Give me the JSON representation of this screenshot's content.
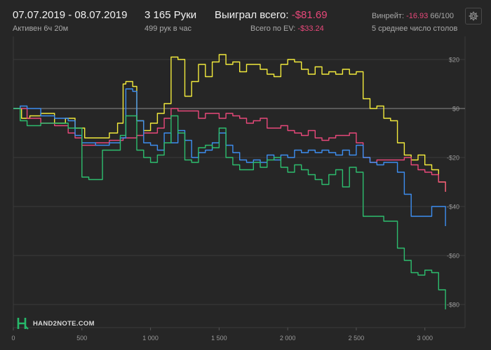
{
  "header": {
    "date_range": "07.07.2019 - 08.07.2019",
    "active_time": "Активен 6ч 20м",
    "hands": "3 165 Руки",
    "hands_per_hour": "499 рук в час",
    "won_label": "Выиграл всего:",
    "won_value": "-$81.69",
    "ev_label": "Всего по EV:",
    "ev_value": "-$33.24",
    "winrate_label": "Винрейт:",
    "winrate_value": "-16.93",
    "winrate_extra": "66/100",
    "tables_avg": "5 среднее число столов",
    "settings_icon": "gear-icon"
  },
  "logo": {
    "text": "HAND2NOTE.COM",
    "icon": "h2n-logo-icon"
  },
  "colors": {
    "background": "#262626",
    "grid": "#3a3a3a",
    "zero_line": "#8c8c8c",
    "yellow": "#f2ea3c",
    "pink": "#e8487a",
    "blue": "#3d8ef0",
    "green": "#2dbd6e"
  },
  "chart_data": {
    "type": "line",
    "xlim": [
      0,
      3165
    ],
    "ylim": [
      -86,
      26
    ],
    "x_ticks": [
      0,
      500,
      1000,
      1500,
      2000,
      2500,
      3000
    ],
    "x_tick_labels": [
      "0",
      "500",
      "1 000",
      "1 500",
      "2 000",
      "2 500",
      "3 000"
    ],
    "y_ticks": [
      20,
      0,
      -20,
      -40,
      -60,
      -80
    ],
    "y_tick_labels": [
      "$20",
      "$0",
      "-$20",
      "-$40",
      "-$60",
      "-$80"
    ],
    "grid": true,
    "series": [
      {
        "color": "#f2ea3c",
        "x": [
          0,
          60,
          120,
          200,
          300,
          380,
          450,
          520,
          600,
          700,
          760,
          800,
          820,
          870,
          900,
          950,
          1000,
          1050,
          1100,
          1150,
          1200,
          1250,
          1300,
          1350,
          1400,
          1450,
          1500,
          1550,
          1600,
          1650,
          1700,
          1750,
          1800,
          1850,
          1900,
          1950,
          2000,
          2050,
          2100,
          2150,
          2200,
          2250,
          2300,
          2350,
          2400,
          2450,
          2500,
          2550,
          2600,
          2650,
          2700,
          2750,
          2800,
          2850,
          2900,
          2950,
          3000,
          3050,
          3100,
          3150
        ],
        "y": [
          0,
          -4,
          -3,
          -2,
          -6,
          -4,
          -8,
          -12,
          -12,
          -10,
          -6,
          10,
          11,
          9,
          -5,
          -9,
          -6,
          -2,
          2,
          21,
          20,
          5,
          11,
          18,
          13,
          19,
          22,
          18,
          19,
          15,
          18,
          18,
          16,
          14,
          13,
          18,
          20,
          19,
          16,
          14,
          17,
          14,
          15,
          14,
          16,
          14,
          15,
          4,
          0,
          1,
          -4,
          -5,
          -14,
          -19,
          -21,
          -19,
          -23,
          -25,
          -30,
          -34
        ]
      },
      {
        "color": "#e8487a",
        "x": [
          0,
          100,
          200,
          300,
          400,
          450,
          500,
          560,
          600,
          700,
          800,
          850,
          900,
          950,
          1000,
          1050,
          1100,
          1150,
          1200,
          1250,
          1300,
          1350,
          1400,
          1450,
          1500,
          1550,
          1600,
          1650,
          1700,
          1750,
          1800,
          1850,
          1900,
          1950,
          2000,
          2050,
          2100,
          2150,
          2200,
          2250,
          2300,
          2350,
          2400,
          2450,
          2500,
          2550,
          2600,
          2650,
          2700,
          2750,
          2800,
          2850,
          2900,
          2950,
          3000,
          3050,
          3100,
          3150
        ],
        "y": [
          0,
          -4,
          -6,
          -7,
          -10,
          -12,
          -15,
          -15,
          -14,
          -13,
          -12,
          -12,
          -11,
          -10,
          -10,
          -8,
          -4,
          0,
          -1,
          -1,
          -1,
          -4,
          -2,
          -2,
          -4,
          -2,
          -3,
          -4,
          -6,
          -5,
          -4,
          -8,
          -8,
          -7,
          -9,
          -10,
          -11,
          -9,
          -12,
          -13,
          -12,
          -11,
          -11,
          -10,
          -14,
          -20,
          -22,
          -21,
          -21,
          -21,
          -21,
          -20,
          -23,
          -25,
          -26,
          -27,
          -30,
          -34
        ]
      },
      {
        "color": "#3d8ef0",
        "x": [
          0,
          50,
          100,
          200,
          300,
          400,
          450,
          500,
          550,
          600,
          700,
          780,
          820,
          870,
          900,
          950,
          1000,
          1050,
          1100,
          1150,
          1200,
          1250,
          1300,
          1350,
          1400,
          1450,
          1500,
          1550,
          1600,
          1650,
          1700,
          1750,
          1800,
          1850,
          1900,
          1950,
          2000,
          2050,
          2100,
          2150,
          2200,
          2250,
          2300,
          2350,
          2400,
          2450,
          2500,
          2550,
          2600,
          2650,
          2700,
          2750,
          2800,
          2850,
          2900,
          2950,
          3000,
          3050,
          3100,
          3150
        ],
        "y": [
          0,
          1,
          0,
          -3,
          -4,
          -5,
          -11,
          -14,
          -14,
          -15,
          -14,
          -12,
          8,
          7,
          -5,
          -14,
          -15,
          -17,
          -10,
          -14,
          -9,
          -13,
          -20,
          -18,
          -17,
          -14,
          -10,
          -15,
          -18,
          -21,
          -22,
          -21,
          -22,
          -19,
          -21,
          -19,
          -20,
          -17,
          -18,
          -17,
          -18,
          -17,
          -18,
          -19,
          -17,
          -19,
          -15,
          -20,
          -22,
          -23,
          -22,
          -22,
          -26,
          -35,
          -44,
          -44,
          -44,
          -40,
          -40,
          -48
        ]
      },
      {
        "color": "#2dbd6e",
        "x": [
          0,
          50,
          100,
          200,
          300,
          400,
          450,
          500,
          550,
          600,
          650,
          700,
          780,
          800,
          820,
          870,
          900,
          950,
          1000,
          1050,
          1100,
          1150,
          1200,
          1250,
          1300,
          1350,
          1400,
          1450,
          1500,
          1550,
          1600,
          1650,
          1700,
          1750,
          1800,
          1850,
          1900,
          1950,
          2000,
          2050,
          2100,
          2150,
          2200,
          2250,
          2300,
          2350,
          2400,
          2450,
          2500,
          2550,
          2600,
          2650,
          2700,
          2750,
          2800,
          2850,
          2900,
          2950,
          3000,
          3050,
          3100,
          3150
        ],
        "y": [
          0,
          -5,
          -7,
          -6,
          -6,
          -8,
          -8,
          -28,
          -29,
          -29,
          -17,
          -17,
          -11,
          -11,
          -3,
          -3,
          -17,
          -20,
          -22,
          -19,
          -14,
          -3,
          -10,
          -21,
          -22,
          -16,
          -15,
          -16,
          -8,
          -20,
          -23,
          -25,
          -25,
          -22,
          -24,
          -21,
          -20,
          -24,
          -26,
          -23,
          -25,
          -27,
          -29,
          -31,
          -27,
          -25,
          -32,
          -24,
          -26,
          -44,
          -44,
          -44,
          -46,
          -46,
          -57,
          -62,
          -67,
          -68,
          -66,
          -67,
          -74,
          -82
        ]
      }
    ]
  }
}
